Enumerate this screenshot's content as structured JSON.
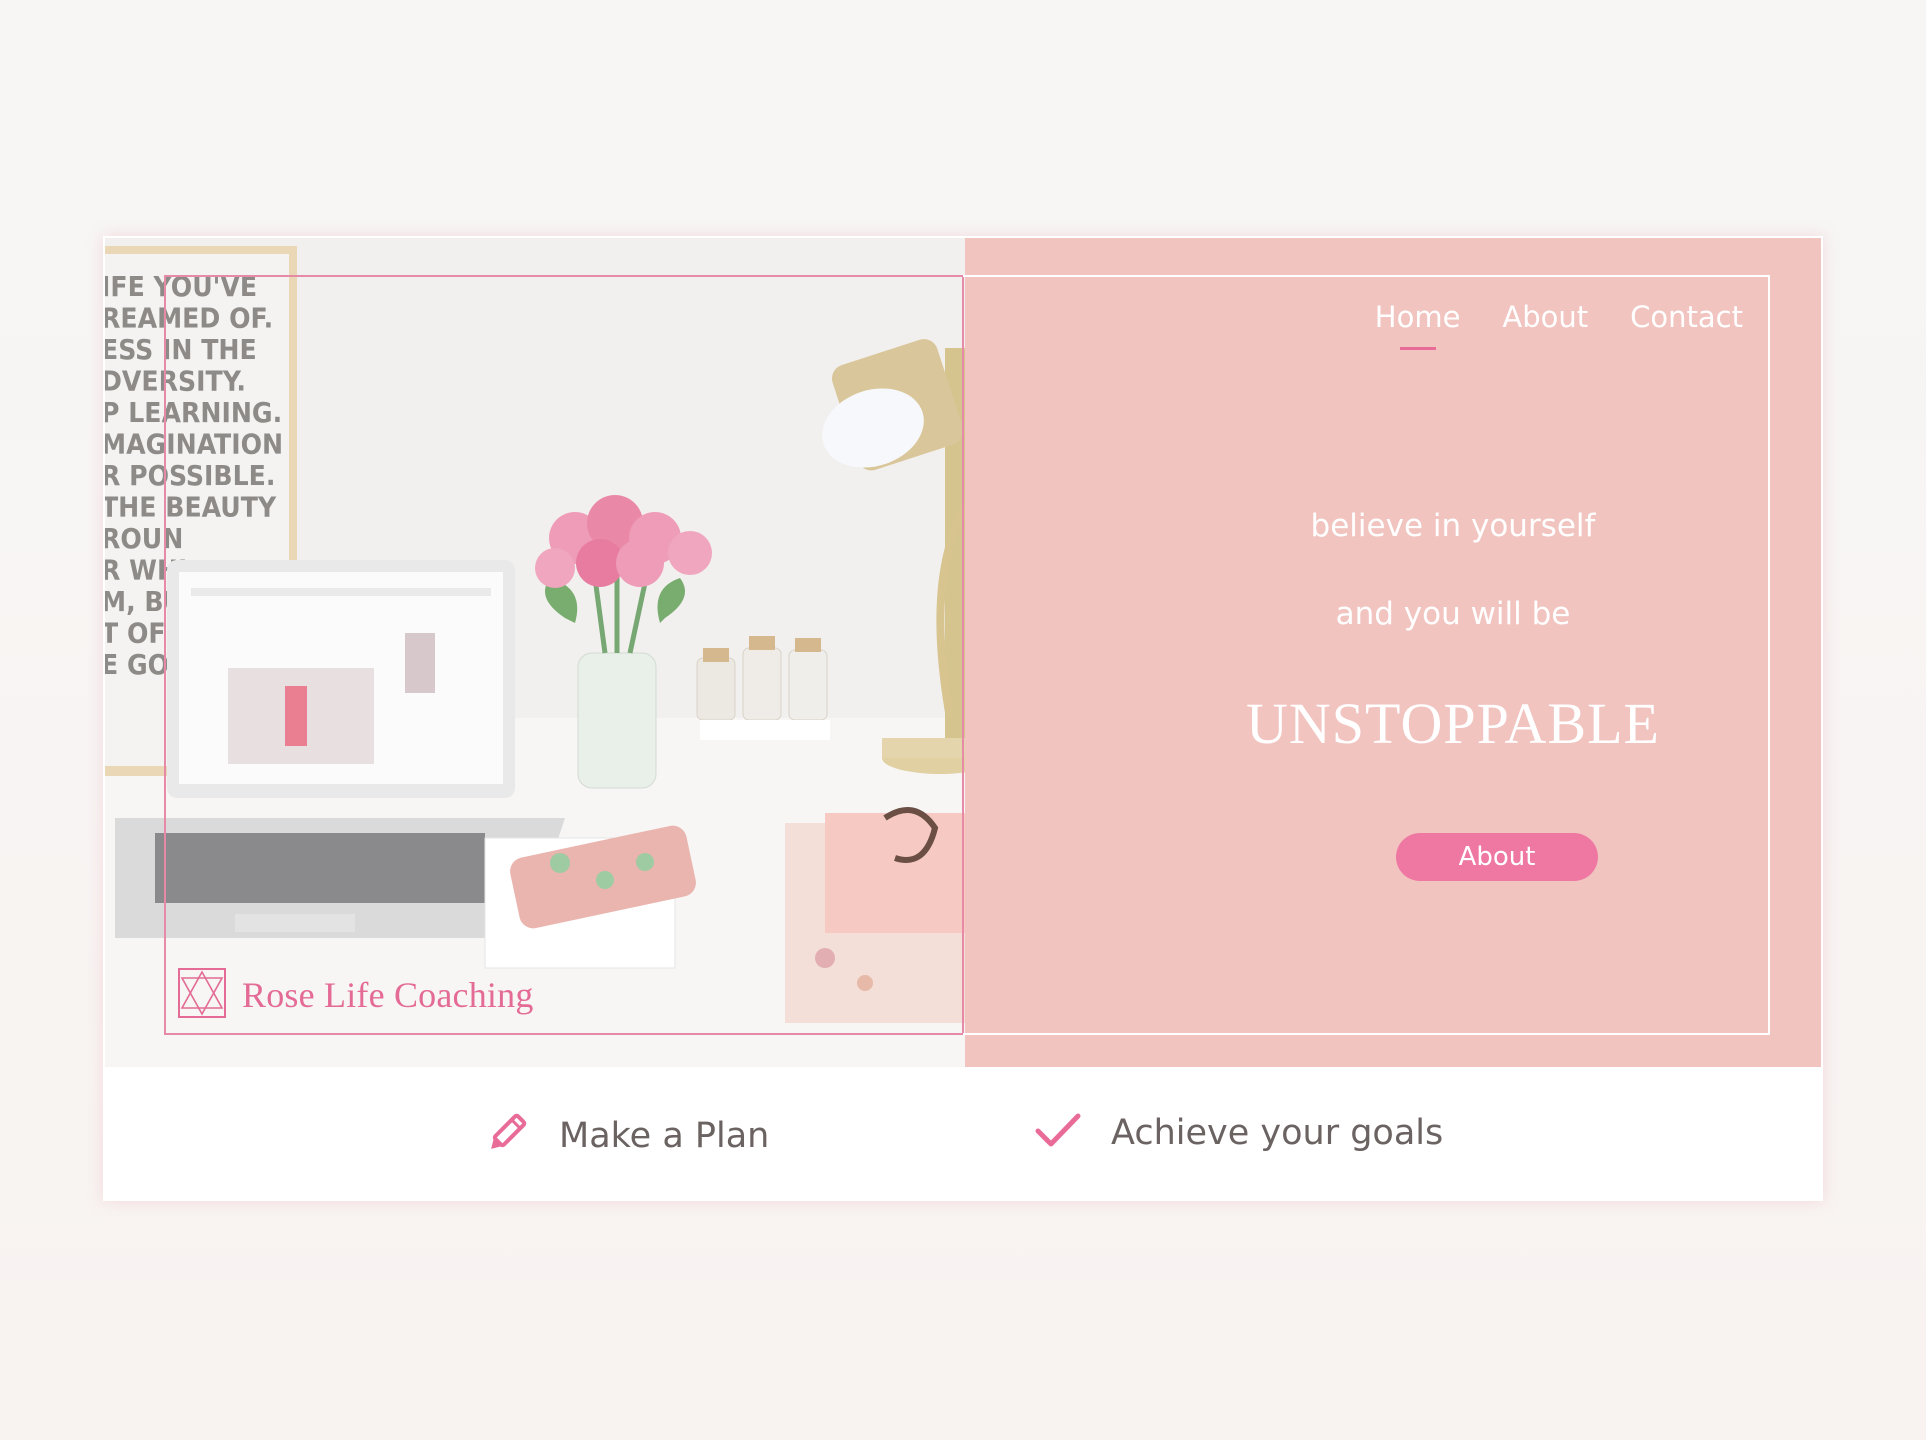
{
  "brand": {
    "name": "Rose Life Coaching",
    "logo_icon": "geometric-star-logo-icon"
  },
  "nav": {
    "items": [
      {
        "label": "Home",
        "active": true
      },
      {
        "label": "About",
        "active": false
      },
      {
        "label": "Contact",
        "active": false
      }
    ]
  },
  "hero": {
    "line1": "believe in yourself",
    "line2": "and you will be",
    "headline": "UNSTOPPABLE",
    "cta_label": "About"
  },
  "poster": {
    "lines": [
      "IFE YOU'VE",
      "REAMED OF.",
      "ESS IN THE",
      "DVERSITY.",
      "P LEARNING.",
      "MAGINATION",
      "R POSSIBLE.",
      "THE BEAUTY",
      "ROUN",
      "R WHI",
      "M, BU",
      "T OF",
      "E GO"
    ]
  },
  "features": [
    {
      "icon": "pencil-icon",
      "label": "Make a Plan"
    },
    {
      "icon": "checkmark-icon",
      "label": "Achieve your goals"
    }
  ],
  "colors": {
    "pink_panel": "#f1c4c0",
    "accent": "#ee78a2",
    "brand_text": "#e36b95",
    "body_text": "#6a6361"
  }
}
